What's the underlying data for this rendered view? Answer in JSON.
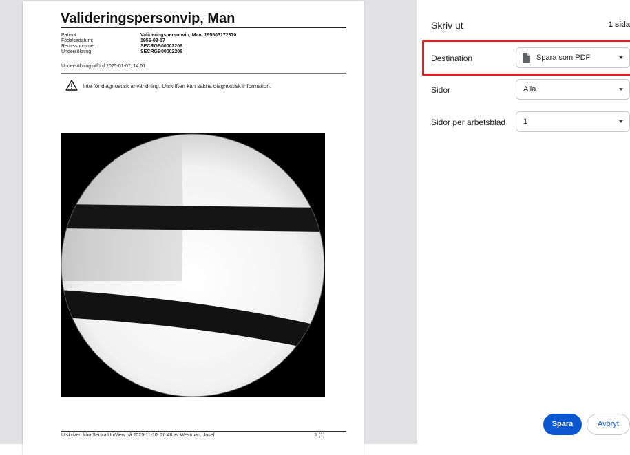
{
  "report": {
    "title": "Valideringspersonvip, Man",
    "fields": [
      {
        "label": "Patient:",
        "value": "Valideringspersonvip, Man, 195503172370"
      },
      {
        "label": "Födelsedatum:",
        "value": "1955-03-17"
      },
      {
        "label": "Remissnummer:",
        "value": "SECRGB00002208"
      },
      {
        "label": "Undersökning:",
        "value": "SECRGB00002208"
      }
    ],
    "exam_time": "Undersökning utförd 2025-01-07, 14:51",
    "warning": "Inte för diagnostisk användning. Utskriften kan sakna diagnostisk information.",
    "footer": "Utskriven från Sectra UniView på 2025-11-10, 20:48 av Westman, Josef",
    "page_number": "1 (1)"
  },
  "panel": {
    "title": "Skriv ut",
    "sheet_count": "1 sida",
    "destination_label": "Destination",
    "destination_value": "Spara som PDF",
    "destination_icon": "document-icon",
    "pages_label": "Sidor",
    "pages_value": "Alla",
    "pages_per_sheet_label": "Sidor per arbetsblad",
    "pages_per_sheet_value": "1",
    "save_label": "Spara",
    "cancel_label": "Avbryt"
  },
  "colors": {
    "primary": "#0b57d0",
    "highlight": "#e01e24",
    "preview_bg": "#e1e1e3"
  }
}
